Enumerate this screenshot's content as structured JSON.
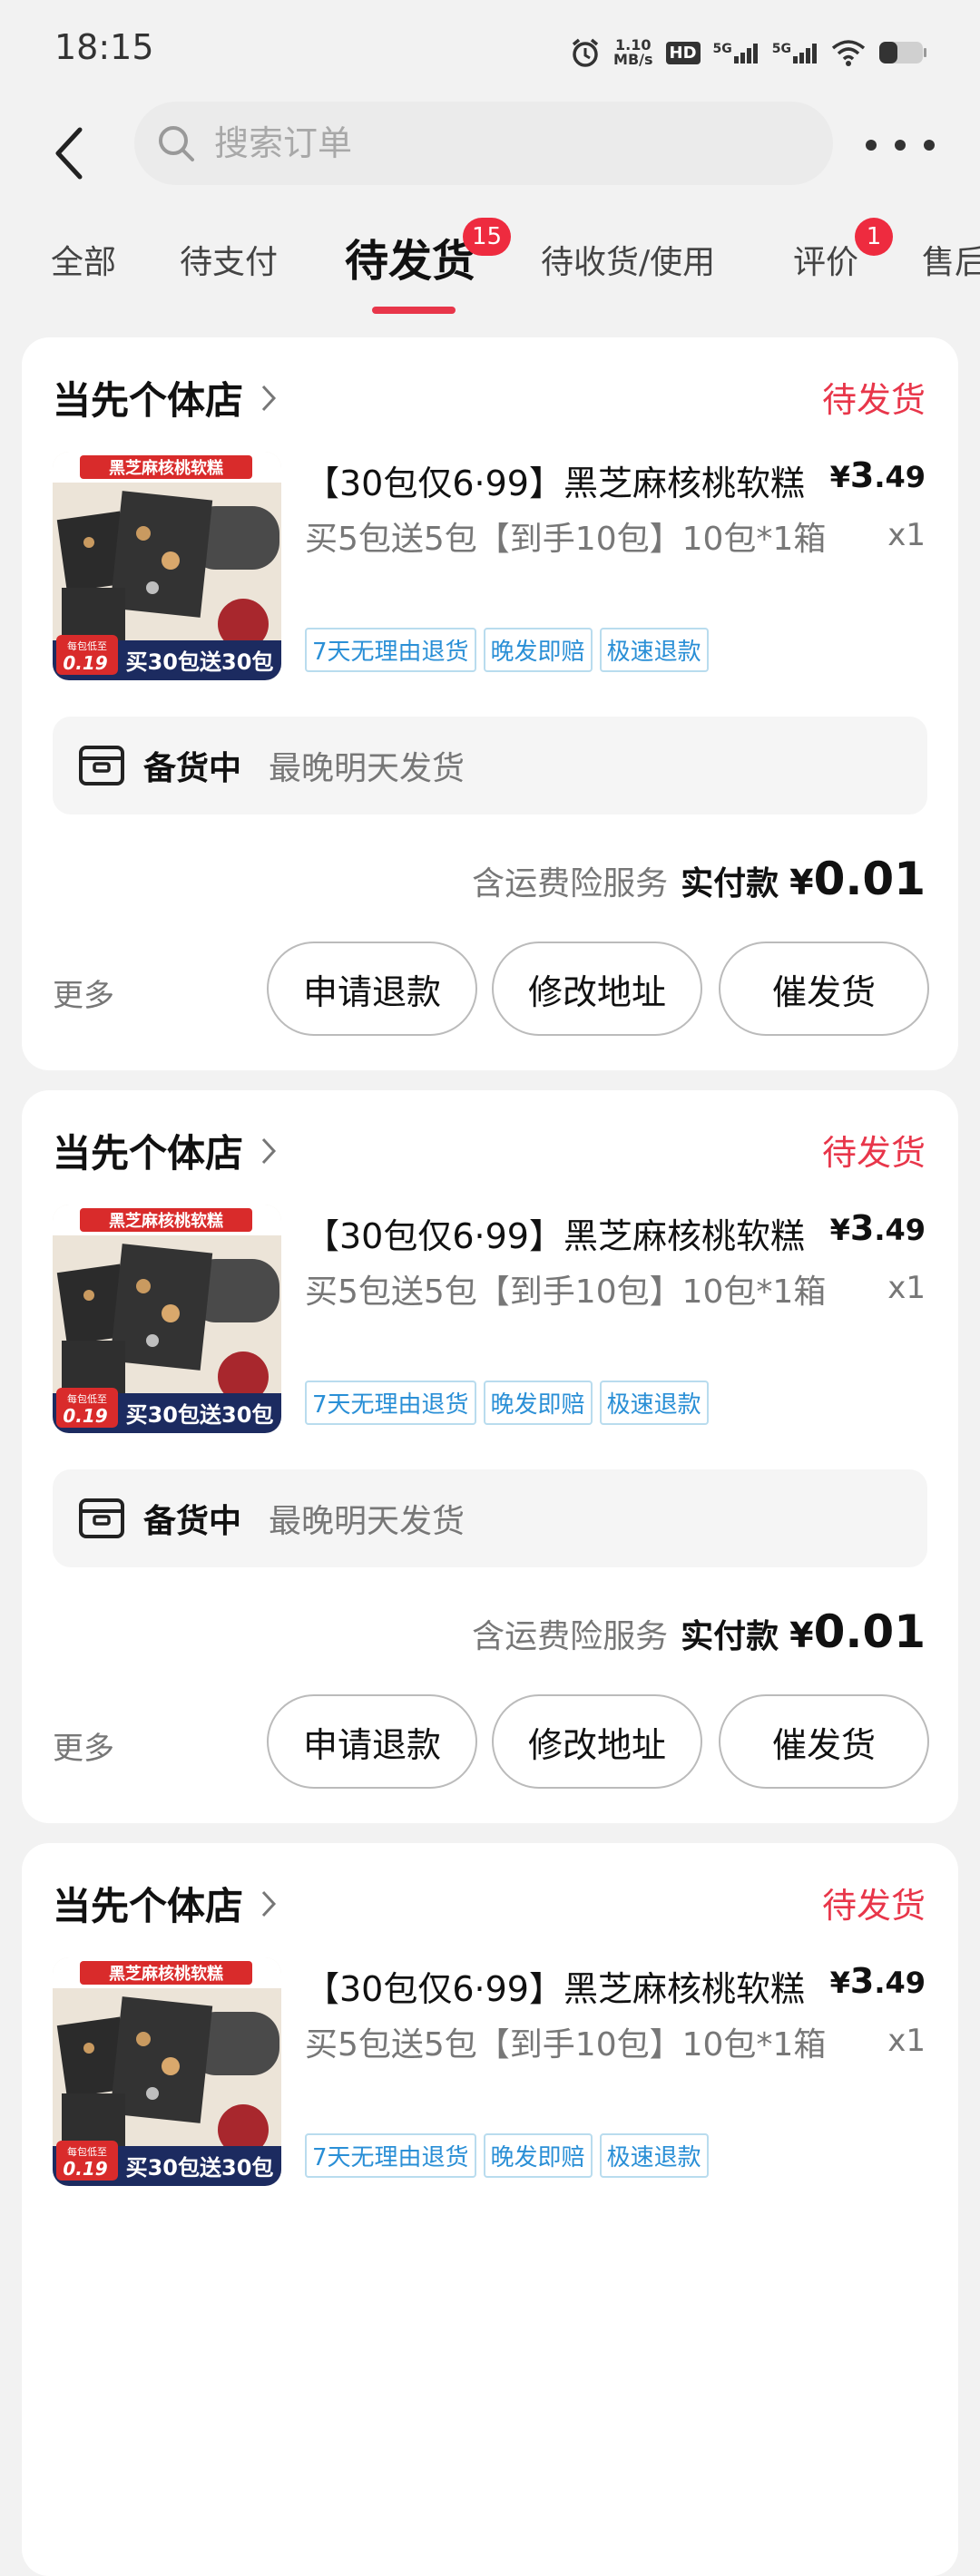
{
  "status_bar": {
    "time": "18:15",
    "net_speed_value": "1.10",
    "net_speed_unit": "MB/s",
    "hd_label": "HD",
    "sim1_label": "5G",
    "sim2_label": "5G"
  },
  "search": {
    "placeholder": "搜索订单"
  },
  "tabs": [
    {
      "label": "全部"
    },
    {
      "label": "待支付"
    },
    {
      "label": "待发货",
      "badge": "15",
      "active": true
    },
    {
      "label": "待收货/使用"
    },
    {
      "label": "评价",
      "badge": "1"
    },
    {
      "label": "售后"
    }
  ],
  "orders": [
    {
      "shop_name": "当先个体店",
      "status": "待发货",
      "image_banner": "黑芝麻核桃软糕",
      "image_caption": "买30包送30包",
      "image_price_label": "每包低至",
      "image_price": "0.19",
      "title": "【30包仅6·99】黑芝麻核桃软糕",
      "price_int": "3",
      "price_dec": ".49",
      "spec": "买5包送5包【到手10包】10包*1箱",
      "qty": "x1",
      "tags": [
        "7天无理由退货",
        "晚发即赔",
        "极速退款"
      ],
      "prep_label": "备货中",
      "prep_note": "最晚明天发货",
      "pay_note": "含运费险服务",
      "pay_label": "实付款",
      "pay_amount": "0.01",
      "more": "更多",
      "buttons": {
        "refund": "申请退款",
        "address": "修改地址",
        "urge": "催发货"
      }
    },
    {
      "shop_name": "当先个体店",
      "status": "待发货",
      "image_banner": "黑芝麻核桃软糕",
      "image_caption": "买30包送30包",
      "image_price_label": "每包低至",
      "image_price": "0.19",
      "title": "【30包仅6·99】黑芝麻核桃软糕",
      "price_int": "3",
      "price_dec": ".49",
      "spec": "买5包送5包【到手10包】10包*1箱",
      "qty": "x1",
      "tags": [
        "7天无理由退货",
        "晚发即赔",
        "极速退款"
      ],
      "prep_label": "备货中",
      "prep_note": "最晚明天发货",
      "pay_note": "含运费险服务",
      "pay_label": "实付款",
      "pay_amount": "0.01",
      "more": "更多",
      "buttons": {
        "refund": "申请退款",
        "address": "修改地址",
        "urge": "催发货"
      }
    },
    {
      "shop_name": "当先个体店",
      "status": "待发货",
      "image_banner": "黑芝麻核桃软糕",
      "image_caption": "买30包送30包",
      "image_price_label": "每包低至",
      "image_price": "0.19",
      "title": "【30包仅6·99】黑芝麻核桃软糕",
      "price_int": "3",
      "price_dec": ".49",
      "spec": "买5包送5包【到手10包】10包*1箱",
      "qty": "x1",
      "tags": [
        "7天无理由退货",
        "晚发即赔",
        "极速退款"
      ]
    }
  ],
  "colors": {
    "accent_red": "#e8364a",
    "badge_red": "#ee2b3f",
    "tag_blue": "#2a8fd6"
  }
}
